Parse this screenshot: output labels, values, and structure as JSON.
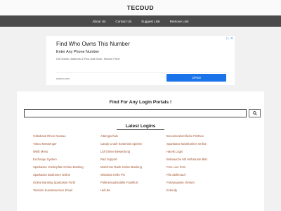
{
  "site": {
    "title": "TECDUD"
  },
  "nav": {
    "items": [
      "About Us",
      "Contact Us",
      "Suggest Link",
      "Remove Link"
    ]
  },
  "ad": {
    "close": "▷ ✕",
    "title": "Find Who Owns This Number",
    "subtitle": "Enter Any Phone Number",
    "description": "Get Name, Address & Pics and More. Search Free!",
    "domain": "spokeo.com",
    "button": "OPEN"
  },
  "main": {
    "heading": "Find For Any Login Portals !",
    "search": {
      "value": "",
      "placeholder": ""
    },
    "latest_title": "Latest Logins",
    "links": [
      [
        "Volksbank Rhein Nassau",
        "Altdorgschule",
        "Benutzerabschließe Fritzbox"
      ],
      [
        "Yahoo Messenger",
        "Candy Crush Kostenlos Spielen",
        "Sparkasse Mainfranken Online"
      ],
      [
        "Weiß Menü",
        "Lidl Online Bewerbung",
        "Harvik Login"
      ],
      [
        "Exchange System",
        "Rad Support",
        "Bebeauche Mit Verbrannte Bild"
      ],
      [
        "Sparkasse Vorderpfalz Online Banking",
        "Münchner Bank Online Banking",
        "Free Live Porn"
      ],
      [
        "Sparkasse Bodensee Online",
        "Windows Hello Pin",
        "Fifa Stellenauf"
      ],
      [
        "Online Banking Sparkasse Fürth",
        "Pollerentaubsstelle Frankfurt",
        "Polizyepasse Viersen"
      ],
      [
        "Telekom Kundenservice Email",
        "Hub.Be",
        "Eckerdy"
      ]
    ]
  }
}
